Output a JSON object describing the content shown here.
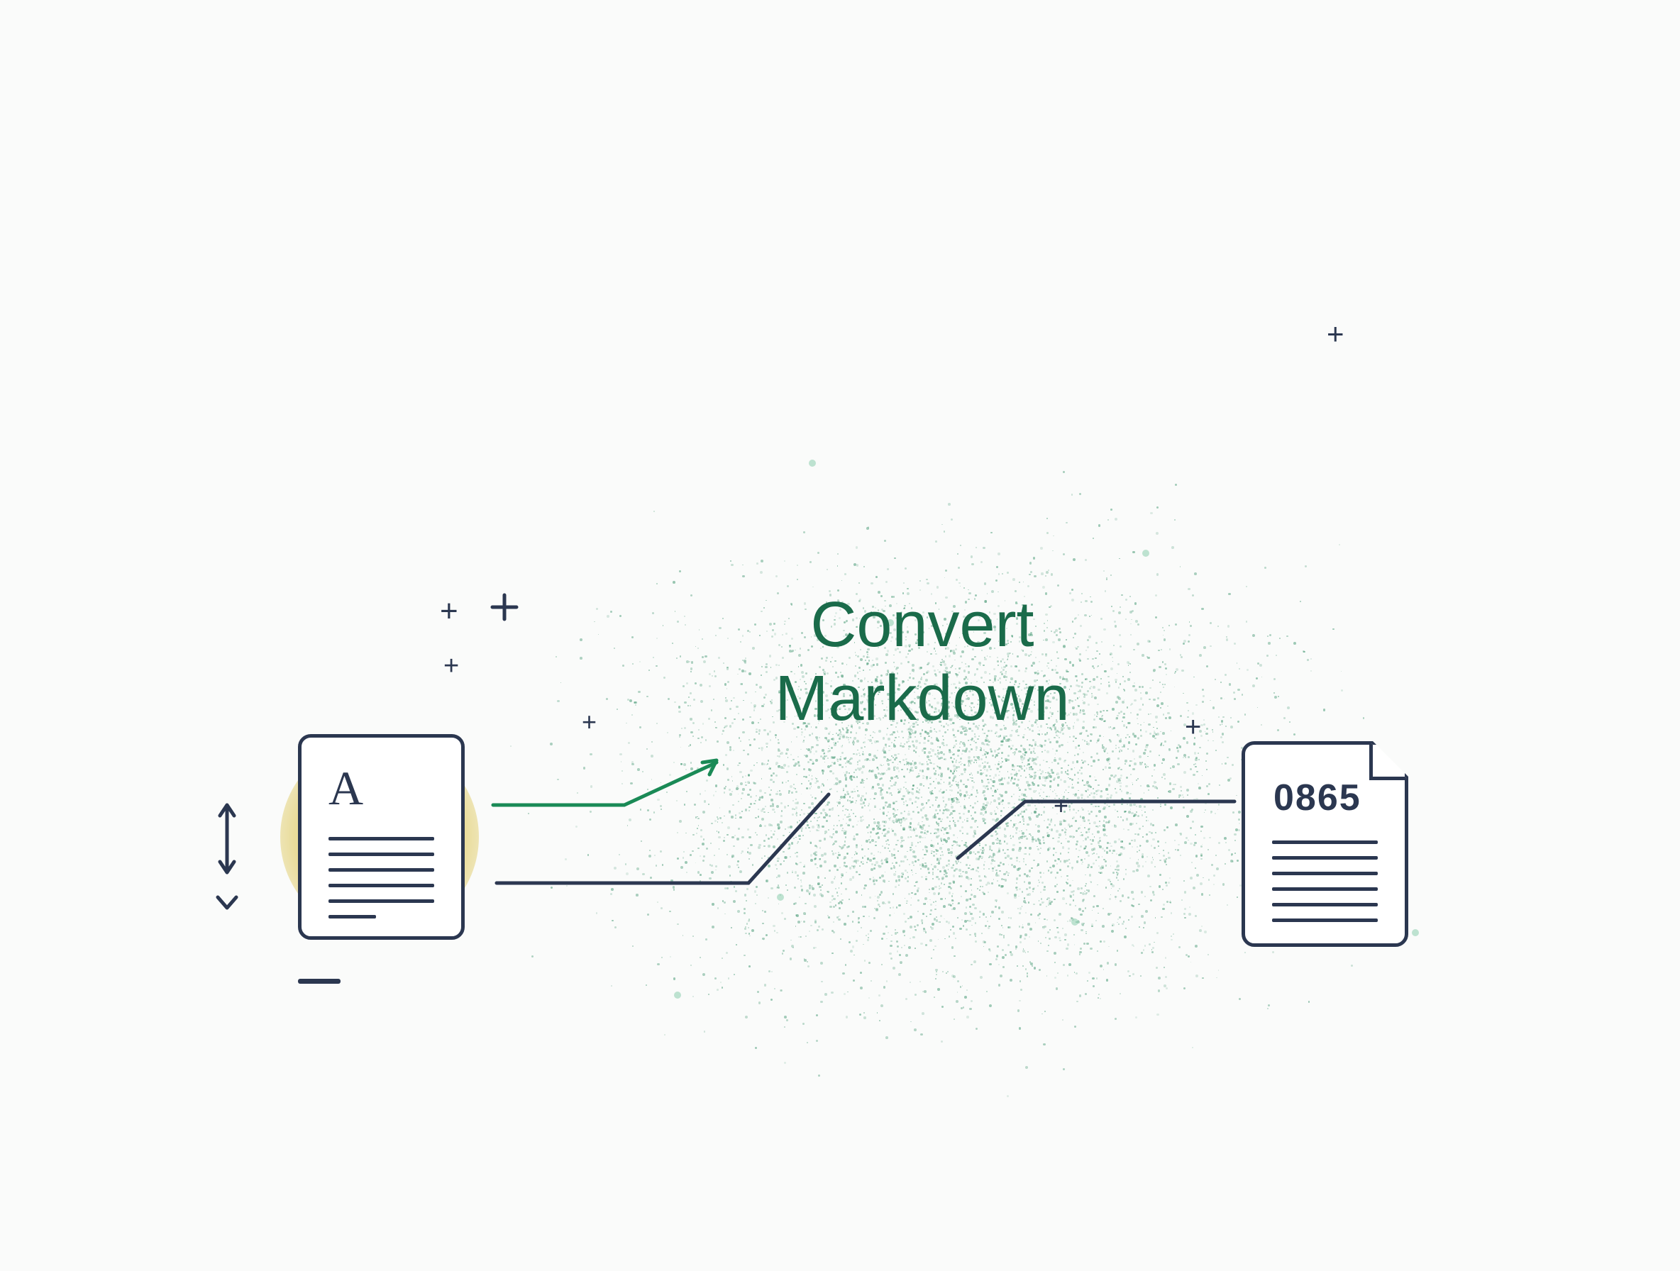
{
  "title_line_1": "Convert",
  "title_line_2": "Markdown",
  "source_doc_label": "A",
  "target_doc_label": "0865"
}
